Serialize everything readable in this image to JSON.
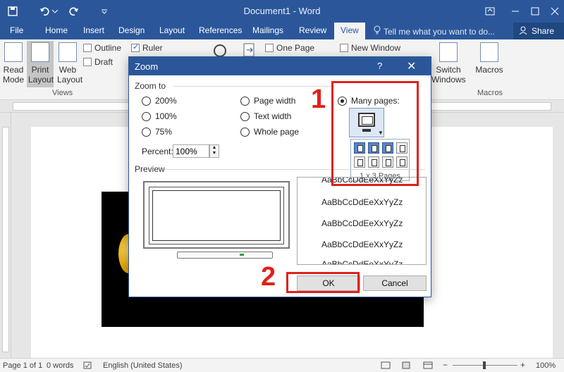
{
  "window": {
    "title": "Document1 - Word",
    "accent": "#2b579a"
  },
  "tabs": [
    {
      "label": "File"
    },
    {
      "label": "Home"
    },
    {
      "label": "Insert"
    },
    {
      "label": "Design"
    },
    {
      "label": "Layout"
    },
    {
      "label": "References"
    },
    {
      "label": "Mailings"
    },
    {
      "label": "Review"
    },
    {
      "label": "View"
    }
  ],
  "tell_me": "Tell me what you want to do...",
  "share": "Share",
  "ribbon": {
    "read_mode": "Read Mode",
    "print_layout": "Print Layout",
    "web_layout": "Web Layout",
    "outline": "Outline",
    "draft": "Draft",
    "views_group": "Views",
    "ruler": "Ruler",
    "one_page": "One Page",
    "new_window": "New Window",
    "switch_windows": "Switch Windows",
    "macros": "Macros",
    "macros_group": "Macros"
  },
  "dialog": {
    "title": "Zoom",
    "help": "?",
    "close": "✕",
    "zoom_to": "Zoom to",
    "options": [
      "200%",
      "100%",
      "75%",
      "Page width",
      "Text width",
      "Whole page",
      "Many pages:"
    ],
    "percent_label": "Percent:",
    "percent_value": "100%",
    "preview_label": "Preview",
    "sample_text": "AaBbCcDdEeXxYyZz",
    "grid_caption": "1 x 3 Pages",
    "ok": "OK",
    "cancel": "Cancel"
  },
  "annotations": {
    "step1": "1",
    "step2": "2",
    "color": "#e0211c"
  },
  "status": {
    "page": "Page 1 of 1",
    "words": "0 words",
    "language": "English (United States)",
    "zoom": "100%"
  }
}
